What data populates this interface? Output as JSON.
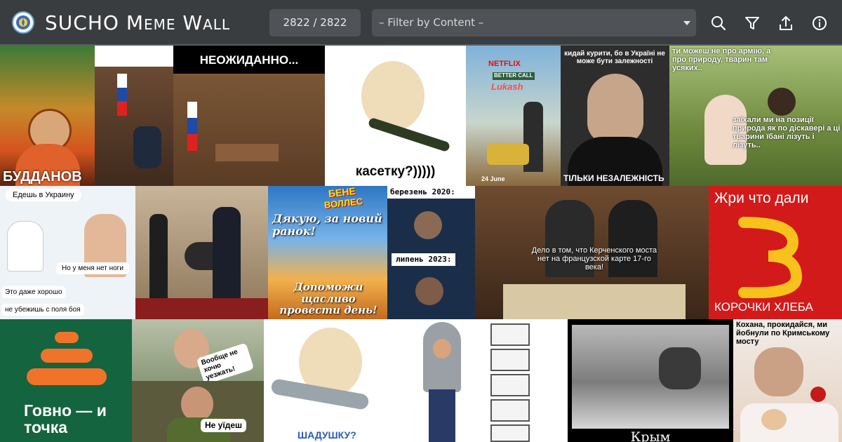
{
  "header": {
    "title": "SUCHO Meme Wall",
    "counter": "2822 / 2822",
    "filter_placeholder": "– Filter by Content –",
    "icons": [
      "search-icon",
      "filter-icon",
      "upload-icon",
      "info-icon"
    ]
  },
  "colors": {
    "header_bg": "#3a3d40",
    "control_bg": "#4f5357",
    "text": "#ffffff"
  },
  "memes": {
    "budanov": "БУДДАНОВ",
    "neozhidanno": "НЕОЖИДАННО...",
    "kasetku": "касетку?)))))",
    "netflix_logo": "NETFLIX",
    "better_call": "BETTER CALL",
    "lukash": "Lukash",
    "june_date": "24 June",
    "kydai_text": "кидай курити, бо в Україні не може бути залежності",
    "tilky": "ТІЛЬКИ НЕЗАЛЕЖНІСТЬ",
    "painting_top": "ти можеш не про армію, а про природу, тварин там усяких..",
    "painting_bottom": "заїхали ми на позиції природа як по діскавері а ці тварини їбані лізуть і лізуть..",
    "ukraine_title": "Едешь в Украину",
    "no_legs": "Но у меня нет ноги",
    "good_line": "Это даже хорошо",
    "run_line": "не убежишь с поля боя",
    "bene_1": "БЕНЕ",
    "bene_2": "ВОЛЛЕС",
    "dyakuyu": "Дякую, за новий ранок!",
    "dopomozhy": "Допоможи щасливо провести день!",
    "berezen": "березень 2020:",
    "lypen": "липень 2023:",
    "kerch": "Дело в том, что Керченского моста нет на французской карте 17-го века!",
    "zhry": "Жри что дали",
    "korochki": "КОРОЧКИ ХЛЕБА",
    "govno": "Говно — и точка",
    "voobshe": "Вообще не хочю уезжать!",
    "ne_yidesh": "Не уїдеш",
    "shadushku": "ШАДУШКУ?",
    "krym": "Крым",
    "kohana": "Кохана, прокидайся, ми йобнули по Кримському мосту"
  }
}
